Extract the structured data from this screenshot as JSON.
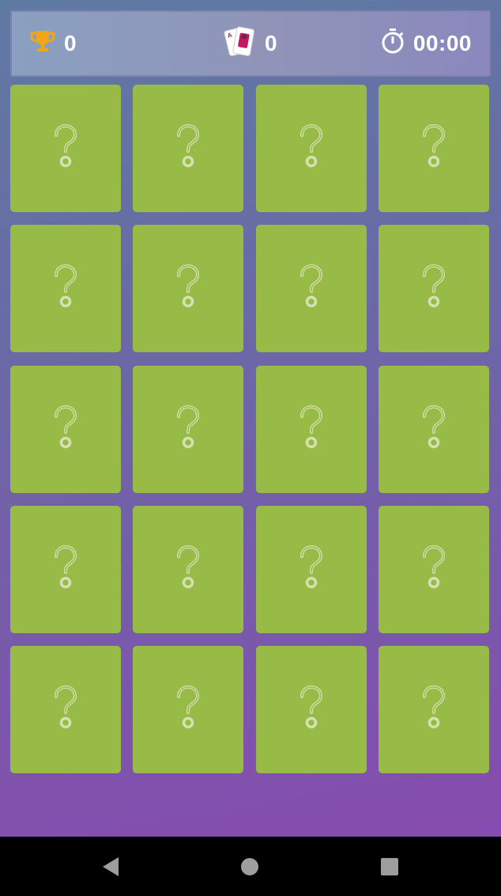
{
  "hud": {
    "score": {
      "icon": "trophy-icon",
      "value": "0"
    },
    "moves": {
      "icon": "cards-icon",
      "value": "0"
    },
    "timer": {
      "icon": "stopwatch-icon",
      "value": "00:00"
    }
  },
  "board": {
    "rows": 5,
    "columns": 4,
    "card_back_icon": "question-mark-icon",
    "cards": [
      "?",
      "?",
      "?",
      "?",
      "?",
      "?",
      "?",
      "?",
      "?",
      "?",
      "?",
      "?",
      "?",
      "?",
      "?",
      "?",
      "?",
      "?",
      "?",
      "?"
    ]
  },
  "colors": {
    "card_back": "#98bb48",
    "trophy": "#f2a516",
    "text": "#ffffff"
  },
  "navbar": {
    "buttons": [
      "back-icon",
      "home-icon",
      "recents-icon"
    ]
  }
}
